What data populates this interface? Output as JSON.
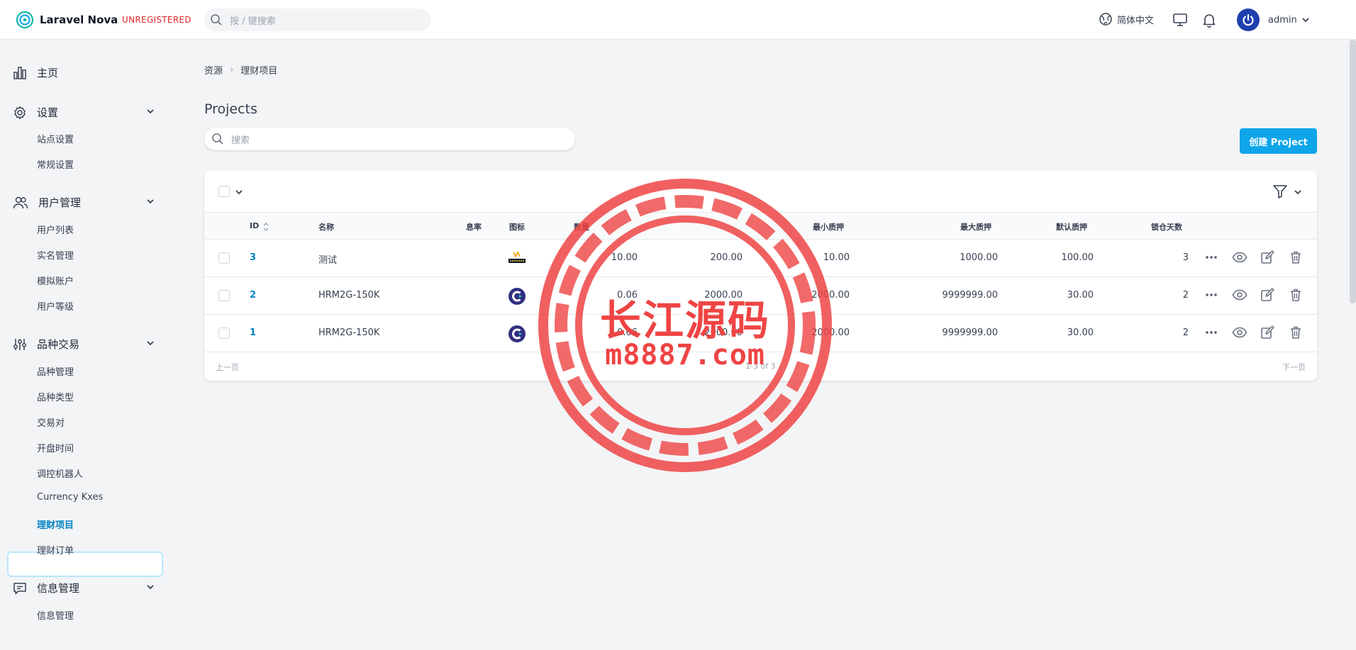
{
  "header": {
    "app_name": "Laravel Nova",
    "badge": "UNREGISTERED",
    "search_placeholder": "按 / 键搜索",
    "language": "简体中文",
    "user": "admin"
  },
  "sidebar": {
    "home": "主页",
    "sections": [
      {
        "label": "设置",
        "items": [
          "站点设置",
          "常规设置"
        ]
      },
      {
        "label": "用户管理",
        "items": [
          "用户列表",
          "实名管理",
          "模拟账户",
          "用户等级"
        ]
      },
      {
        "label": "品种交易",
        "items": [
          "品种管理",
          "品种类型",
          "交易对",
          "开盘时间",
          "调控机器人",
          "Currency Kxes",
          "理财项目",
          "理财订单"
        ]
      },
      {
        "label": "信息管理",
        "items": [
          "信息管理"
        ]
      }
    ],
    "active": "理财项目"
  },
  "breadcrumb": {
    "root": "资源",
    "current": "理财项目"
  },
  "page": {
    "title": "Projects",
    "search_placeholder": "搜索",
    "create_label": "创建 Project"
  },
  "table": {
    "columns": [
      "ID",
      "名称",
      "图标",
      "息率",
      "数量",
      "最小质押",
      "最大质押",
      "默认质押",
      "锁仓天数"
    ],
    "rows": [
      {
        "id": "3",
        "name": "测试",
        "icon": "exness-logo",
        "rate": "10.00",
        "qty": "200.00",
        "min": "10.00",
        "max": "1000.00",
        "default": "100.00",
        "days": "3"
      },
      {
        "id": "2",
        "name": "HRM2G-150K",
        "icon": "c-logo",
        "rate": "0.06",
        "qty": "2000.00",
        "min": "2000.00",
        "max": "9999999.00",
        "default": "30.00",
        "days": "2"
      },
      {
        "id": "1",
        "name": "HRM2G-150K",
        "icon": "c-logo",
        "rate": "0.06",
        "qty": "2000.00",
        "min": "2000.00",
        "max": "9999999.00",
        "default": "30.00",
        "days": "2"
      }
    ]
  },
  "pager": {
    "prev": "上一页",
    "info": "1-3 of 3",
    "next": "下一页"
  },
  "watermark": {
    "line1": "长江源码",
    "line2": "m8887.com"
  },
  "colors": {
    "accent": "#0ea5e9",
    "link": "#0284c7",
    "unregistered": "#dc2626",
    "watermark": "#ef4444"
  }
}
